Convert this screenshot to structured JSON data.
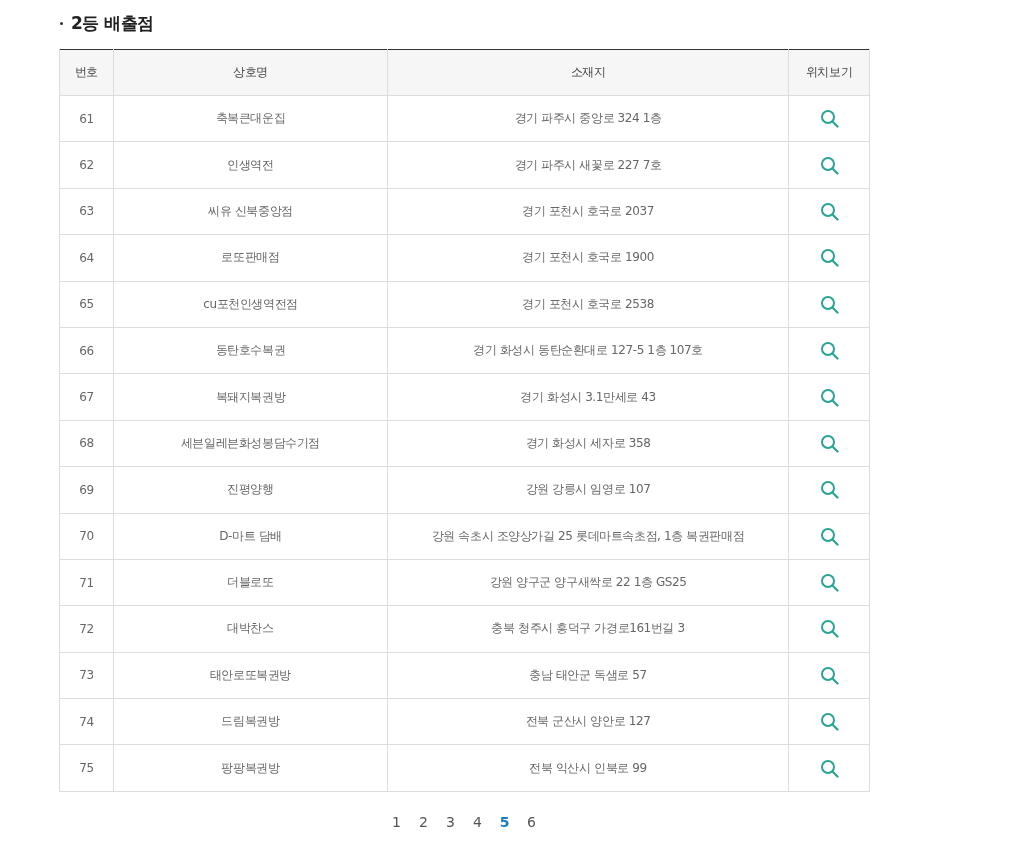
{
  "section_title": "2등 배출점",
  "table": {
    "columns": [
      "번호",
      "상호명",
      "소재지",
      "위치보기"
    ],
    "rows": [
      {
        "no": "61",
        "name": "축복큰대운집",
        "address": "경기 파주시 중앙로 324 1층"
      },
      {
        "no": "62",
        "name": "인생역전",
        "address": "경기 파주시 새꽃로 227 7호"
      },
      {
        "no": "63",
        "name": "씨유 신북중앙점",
        "address": "경기 포천시 호국로 2037"
      },
      {
        "no": "64",
        "name": "로또판매점",
        "address": "경기 포천시 호국로 1900"
      },
      {
        "no": "65",
        "name": "cu포천인생역전점",
        "address": "경기 포천시 호국로 2538"
      },
      {
        "no": "66",
        "name": "동탄호수복권",
        "address": "경기 화성시 동탄순환대로 127-5 1층 107호"
      },
      {
        "no": "67",
        "name": "복돼지복권방",
        "address": "경기 화성시 3.1만세로 43"
      },
      {
        "no": "68",
        "name": "세븐일레븐화성봉담수기점",
        "address": "경기 화성시 세자로 358"
      },
      {
        "no": "69",
        "name": "진평양행",
        "address": "강원 강릉시 임영로 107"
      },
      {
        "no": "70",
        "name": "D-마트 담배",
        "address": "강원 속초시 조양상가길 25 롯데마트속초점, 1층 복권판매점"
      },
      {
        "no": "71",
        "name": "더블로또",
        "address": "강원 양구군 양구새싹로 22 1층 GS25"
      },
      {
        "no": "72",
        "name": "대박찬스",
        "address": "충북 청주시 흥덕구 가경로161번길 3"
      },
      {
        "no": "73",
        "name": "태안로또복권방",
        "address": "충남 태안군 독샘로 57"
      },
      {
        "no": "74",
        "name": "드림복권방",
        "address": "전북 군산시 양안로 127"
      },
      {
        "no": "75",
        "name": "팡팡복권방",
        "address": "전북 익산시 인북로 99"
      }
    ]
  },
  "pagination": [
    {
      "label": "1",
      "selected": false
    },
    {
      "label": "2",
      "selected": false
    },
    {
      "label": "3",
      "selected": false
    },
    {
      "label": "4",
      "selected": false
    },
    {
      "label": "5",
      "selected": true
    },
    {
      "label": "6",
      "selected": false
    }
  ]
}
